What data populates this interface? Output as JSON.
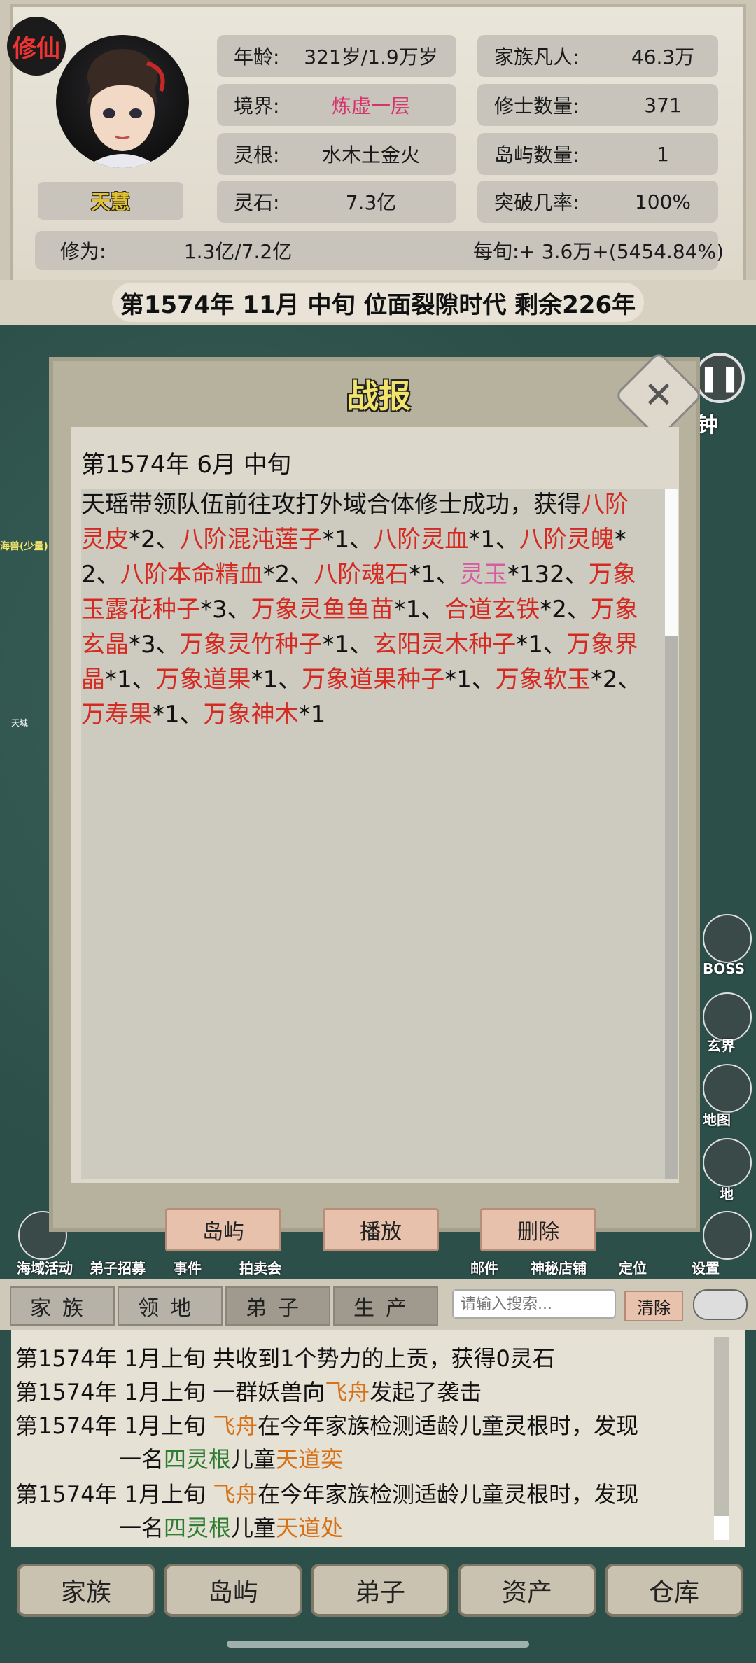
{
  "header": {
    "seal": "修仙",
    "name": "天慧",
    "stats_left": [
      {
        "label": "年龄:",
        "value": "321岁/1.9万岁"
      },
      {
        "label": "境界:",
        "value": "炼虚一层"
      },
      {
        "label": "灵根:",
        "value": "水木土金火"
      },
      {
        "label": "灵石:",
        "value": "7.3亿"
      }
    ],
    "stats_right": [
      {
        "label": "家族凡人:",
        "value": "46.3万"
      },
      {
        "label": "修士数量:",
        "value": "371"
      },
      {
        "label": "岛屿数量:",
        "value": "1"
      },
      {
        "label": "突破几率:",
        "value": "100%"
      }
    ],
    "cultivation": {
      "label": "修为:",
      "value": "1.3亿/7.2亿",
      "rate": "每旬:+ 3.6万+(5454.84%)"
    },
    "era": "第1574年 11月 中旬  位面裂隙时代 剩余226年",
    "realm_color": "#d6336c"
  },
  "modal": {
    "title": "战报",
    "close_icon": "close-icon",
    "date": "第1574年 6月 中旬",
    "text": {
      "intro": "天瑶带领队伍前往攻打外域合体修士成功，获得",
      "items": [
        {
          "name": "八阶灵皮",
          "qty": "*2"
        },
        {
          "name": "八阶混沌莲子",
          "qty": "*1"
        },
        {
          "name": "八阶灵血",
          "qty": "*1"
        },
        {
          "name": "八阶灵魄",
          "qty": "*2"
        },
        {
          "name": "八阶本命精血",
          "qty": "*2"
        },
        {
          "name": "八阶魂石",
          "qty": "*1"
        },
        {
          "name": "灵玉",
          "qty": "*132"
        },
        {
          "name": "万象玉露花种子",
          "qty": "*3"
        },
        {
          "name": "万象灵鱼鱼苗",
          "qty": "*1"
        },
        {
          "name": "合道玄铁",
          "qty": "*2"
        },
        {
          "name": "万象玄晶",
          "qty": "*3"
        },
        {
          "name": "万象灵竹种子",
          "qty": "*1"
        },
        {
          "name": "玄阳灵木种子",
          "qty": "*1"
        },
        {
          "name": "万象界晶",
          "qty": "*1"
        },
        {
          "name": "万象道果",
          "qty": "*1"
        },
        {
          "name": "万象道果种子",
          "qty": "*1"
        },
        {
          "name": "万象软玉",
          "qty": "*2"
        },
        {
          "name": "万寿果",
          "qty": "*1"
        },
        {
          "name": "万象神木",
          "qty": "*1"
        }
      ]
    },
    "buttons": [
      "岛屿",
      "播放",
      "删除"
    ]
  },
  "side": {
    "right_labels": [
      "钟",
      "BOSS",
      "玄界",
      "地图",
      "地"
    ],
    "left_labels": [
      "海域活动",
      "弟子招募",
      "事件",
      "拍卖会"
    ],
    "right_bottom_labels": [
      "邮件",
      "神秘店铺",
      "定位",
      "设置"
    ],
    "map_labels": [
      "海兽(少量)",
      "天域"
    ]
  },
  "tabs": {
    "items": [
      "家族",
      "领地",
      "弟子",
      "生产"
    ],
    "search_placeholder": "请输入搜索...",
    "clear": "清除"
  },
  "log": [
    {
      "date": "第1574年 1月上旬",
      "parts": [
        {
          "t": "共收到1个势力的上贡，获得0灵石",
          "c": ""
        }
      ]
    },
    {
      "date": "第1574年 1月上旬",
      "parts": [
        {
          "t": "一群妖兽向",
          "c": ""
        },
        {
          "t": "飞舟",
          "c": "o"
        },
        {
          "t": "发起了袭击",
          "c": ""
        }
      ]
    },
    {
      "date": "第1574年 1月上旬",
      "parts": [
        {
          "t": "飞舟",
          "c": "o"
        },
        {
          "t": "在今年家族检测适龄儿童灵根时，发现",
          "c": ""
        }
      ],
      "cont": [
        {
          "t": "一名",
          "c": ""
        },
        {
          "t": "四灵根",
          "c": "g"
        },
        {
          "t": "儿童",
          "c": ""
        },
        {
          "t": "天道奕",
          "c": "o"
        }
      ]
    },
    {
      "date": "第1574年 1月上旬",
      "parts": [
        {
          "t": "飞舟",
          "c": "o"
        },
        {
          "t": "在今年家族检测适龄儿童灵根时，发现",
          "c": ""
        }
      ],
      "cont": [
        {
          "t": "一名",
          "c": ""
        },
        {
          "t": "四灵根",
          "c": "g"
        },
        {
          "t": "儿童",
          "c": ""
        },
        {
          "t": "天道处",
          "c": "o"
        }
      ]
    }
  ],
  "nav": [
    "家族",
    "岛屿",
    "弟子",
    "资产",
    "仓库"
  ]
}
